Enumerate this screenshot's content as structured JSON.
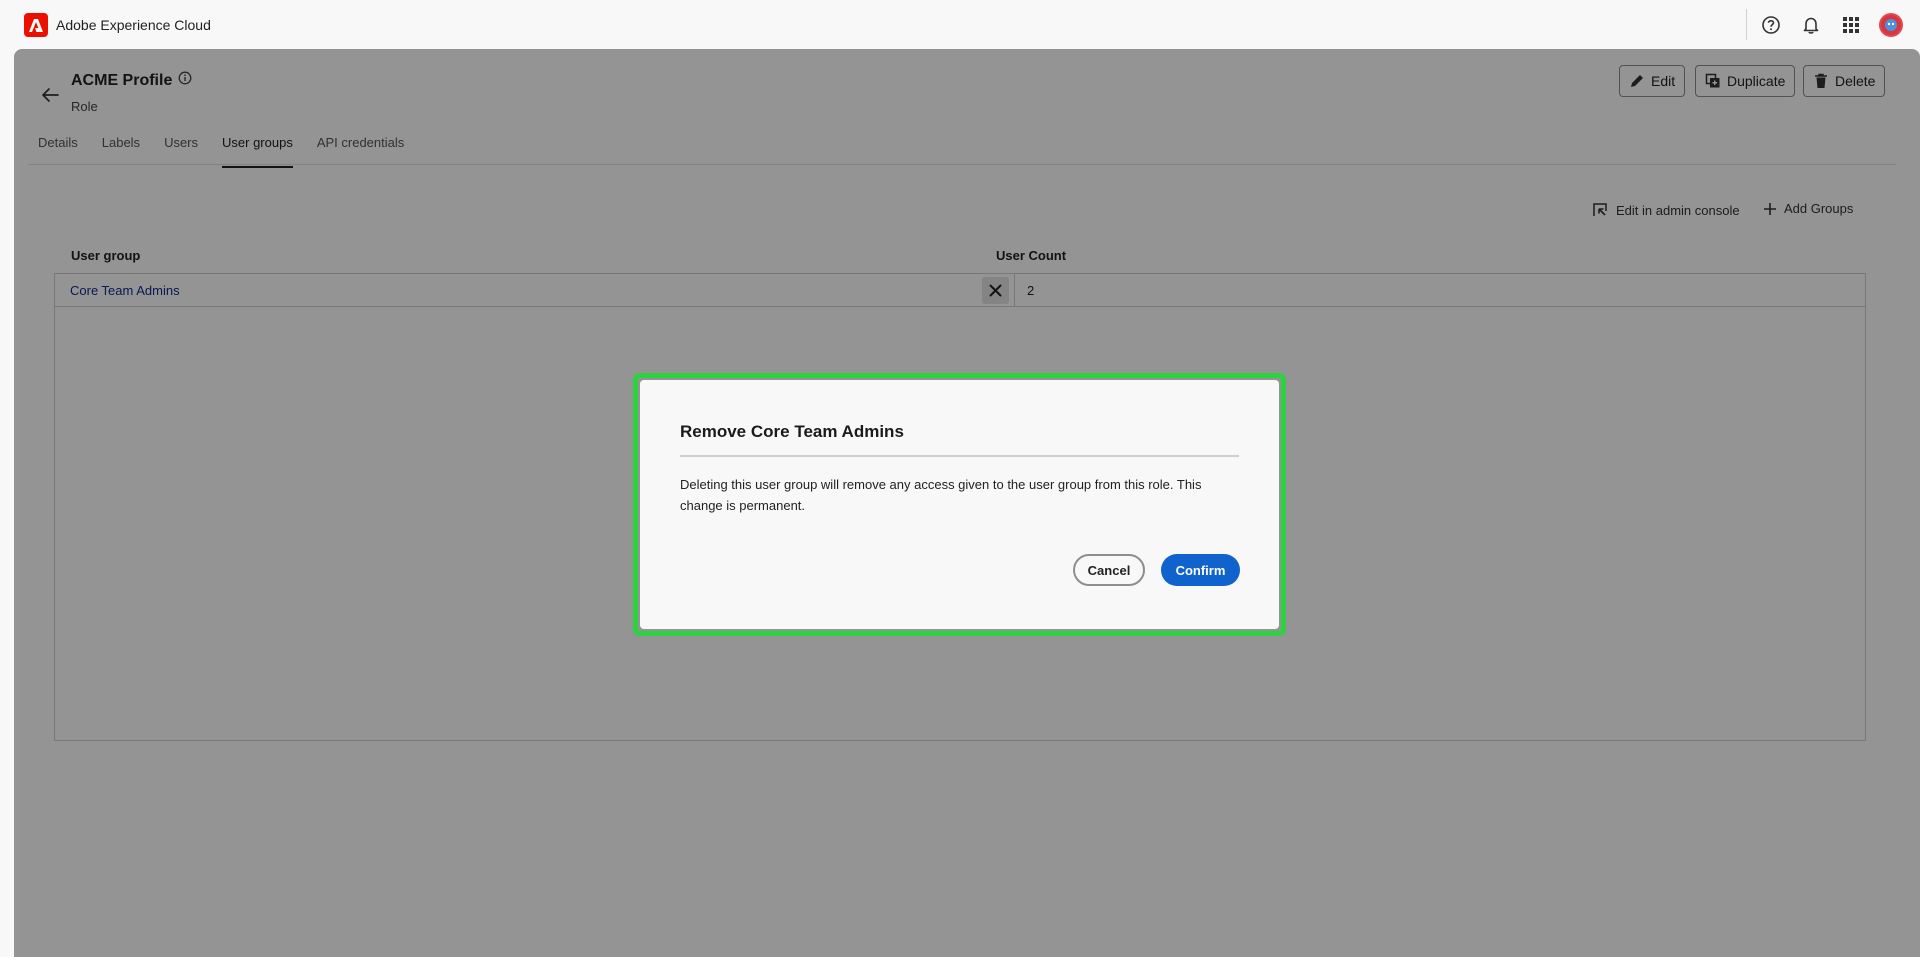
{
  "app": {
    "name": "Adobe Experience Cloud",
    "colors": {
      "brand": "#eb1000",
      "accent": "#1062cc",
      "highlight": "#2ed13f"
    }
  },
  "topbar": {
    "icons": [
      "help-icon",
      "bell-icon",
      "apps-grid-icon",
      "avatar"
    ]
  },
  "header": {
    "title": "ACME Profile",
    "subtitle": "Role",
    "buttons": {
      "edit": "Edit",
      "duplicate": "Duplicate",
      "delete": "Delete"
    }
  },
  "tabs": [
    {
      "label": "Details",
      "active": false
    },
    {
      "label": "Labels",
      "active": false
    },
    {
      "label": "Users",
      "active": false
    },
    {
      "label": "User groups",
      "active": true
    },
    {
      "label": "API credentials",
      "active": false
    }
  ],
  "actions": {
    "edit_admin": "Edit in admin console",
    "add_groups": "Add Groups"
  },
  "table": {
    "columns": [
      "User group",
      "User Count"
    ],
    "rows": [
      {
        "user_group": "Core Team Admins",
        "user_count": "2"
      }
    ]
  },
  "dialog": {
    "title": "Remove Core Team Admins",
    "body": "Deleting this user group will remove any access given to the user group from this role. This change is permanent.",
    "cancel": "Cancel",
    "confirm": "Confirm"
  }
}
